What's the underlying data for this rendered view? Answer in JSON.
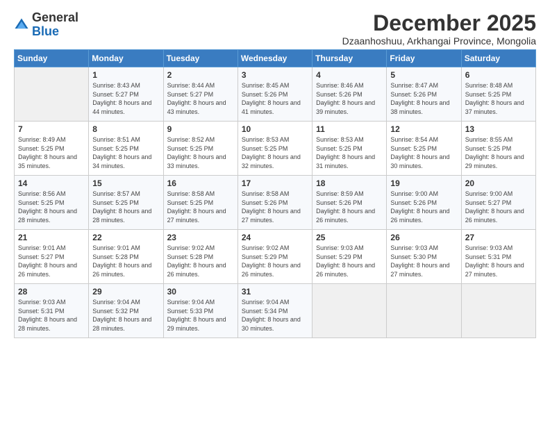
{
  "logo": {
    "general": "General",
    "blue": "Blue"
  },
  "header": {
    "month_year": "December 2025",
    "location": "Dzaanhoshuu, Arkhangai Province, Mongolia"
  },
  "days_of_week": [
    "Sunday",
    "Monday",
    "Tuesday",
    "Wednesday",
    "Thursday",
    "Friday",
    "Saturday"
  ],
  "weeks": [
    [
      {
        "day": "",
        "sunrise": "",
        "sunset": "",
        "daylight": ""
      },
      {
        "day": "1",
        "sunrise": "Sunrise: 8:43 AM",
        "sunset": "Sunset: 5:27 PM",
        "daylight": "Daylight: 8 hours and 44 minutes."
      },
      {
        "day": "2",
        "sunrise": "Sunrise: 8:44 AM",
        "sunset": "Sunset: 5:27 PM",
        "daylight": "Daylight: 8 hours and 43 minutes."
      },
      {
        "day": "3",
        "sunrise": "Sunrise: 8:45 AM",
        "sunset": "Sunset: 5:26 PM",
        "daylight": "Daylight: 8 hours and 41 minutes."
      },
      {
        "day": "4",
        "sunrise": "Sunrise: 8:46 AM",
        "sunset": "Sunset: 5:26 PM",
        "daylight": "Daylight: 8 hours and 39 minutes."
      },
      {
        "day": "5",
        "sunrise": "Sunrise: 8:47 AM",
        "sunset": "Sunset: 5:26 PM",
        "daylight": "Daylight: 8 hours and 38 minutes."
      },
      {
        "day": "6",
        "sunrise": "Sunrise: 8:48 AM",
        "sunset": "Sunset: 5:25 PM",
        "daylight": "Daylight: 8 hours and 37 minutes."
      }
    ],
    [
      {
        "day": "7",
        "sunrise": "Sunrise: 8:49 AM",
        "sunset": "Sunset: 5:25 PM",
        "daylight": "Daylight: 8 hours and 35 minutes."
      },
      {
        "day": "8",
        "sunrise": "Sunrise: 8:51 AM",
        "sunset": "Sunset: 5:25 PM",
        "daylight": "Daylight: 8 hours and 34 minutes."
      },
      {
        "day": "9",
        "sunrise": "Sunrise: 8:52 AM",
        "sunset": "Sunset: 5:25 PM",
        "daylight": "Daylight: 8 hours and 33 minutes."
      },
      {
        "day": "10",
        "sunrise": "Sunrise: 8:53 AM",
        "sunset": "Sunset: 5:25 PM",
        "daylight": "Daylight: 8 hours and 32 minutes."
      },
      {
        "day": "11",
        "sunrise": "Sunrise: 8:53 AM",
        "sunset": "Sunset: 5:25 PM",
        "daylight": "Daylight: 8 hours and 31 minutes."
      },
      {
        "day": "12",
        "sunrise": "Sunrise: 8:54 AM",
        "sunset": "Sunset: 5:25 PM",
        "daylight": "Daylight: 8 hours and 30 minutes."
      },
      {
        "day": "13",
        "sunrise": "Sunrise: 8:55 AM",
        "sunset": "Sunset: 5:25 PM",
        "daylight": "Daylight: 8 hours and 29 minutes."
      }
    ],
    [
      {
        "day": "14",
        "sunrise": "Sunrise: 8:56 AM",
        "sunset": "Sunset: 5:25 PM",
        "daylight": "Daylight: 8 hours and 28 minutes."
      },
      {
        "day": "15",
        "sunrise": "Sunrise: 8:57 AM",
        "sunset": "Sunset: 5:25 PM",
        "daylight": "Daylight: 8 hours and 28 minutes."
      },
      {
        "day": "16",
        "sunrise": "Sunrise: 8:58 AM",
        "sunset": "Sunset: 5:25 PM",
        "daylight": "Daylight: 8 hours and 27 minutes."
      },
      {
        "day": "17",
        "sunrise": "Sunrise: 8:58 AM",
        "sunset": "Sunset: 5:26 PM",
        "daylight": "Daylight: 8 hours and 27 minutes."
      },
      {
        "day": "18",
        "sunrise": "Sunrise: 8:59 AM",
        "sunset": "Sunset: 5:26 PM",
        "daylight": "Daylight: 8 hours and 26 minutes."
      },
      {
        "day": "19",
        "sunrise": "Sunrise: 9:00 AM",
        "sunset": "Sunset: 5:26 PM",
        "daylight": "Daylight: 8 hours and 26 minutes."
      },
      {
        "day": "20",
        "sunrise": "Sunrise: 9:00 AM",
        "sunset": "Sunset: 5:27 PM",
        "daylight": "Daylight: 8 hours and 26 minutes."
      }
    ],
    [
      {
        "day": "21",
        "sunrise": "Sunrise: 9:01 AM",
        "sunset": "Sunset: 5:27 PM",
        "daylight": "Daylight: 8 hours and 26 minutes."
      },
      {
        "day": "22",
        "sunrise": "Sunrise: 9:01 AM",
        "sunset": "Sunset: 5:28 PM",
        "daylight": "Daylight: 8 hours and 26 minutes."
      },
      {
        "day": "23",
        "sunrise": "Sunrise: 9:02 AM",
        "sunset": "Sunset: 5:28 PM",
        "daylight": "Daylight: 8 hours and 26 minutes."
      },
      {
        "day": "24",
        "sunrise": "Sunrise: 9:02 AM",
        "sunset": "Sunset: 5:29 PM",
        "daylight": "Daylight: 8 hours and 26 minutes."
      },
      {
        "day": "25",
        "sunrise": "Sunrise: 9:03 AM",
        "sunset": "Sunset: 5:29 PM",
        "daylight": "Daylight: 8 hours and 26 minutes."
      },
      {
        "day": "26",
        "sunrise": "Sunrise: 9:03 AM",
        "sunset": "Sunset: 5:30 PM",
        "daylight": "Daylight: 8 hours and 27 minutes."
      },
      {
        "day": "27",
        "sunrise": "Sunrise: 9:03 AM",
        "sunset": "Sunset: 5:31 PM",
        "daylight": "Daylight: 8 hours and 27 minutes."
      }
    ],
    [
      {
        "day": "28",
        "sunrise": "Sunrise: 9:03 AM",
        "sunset": "Sunset: 5:31 PM",
        "daylight": "Daylight: 8 hours and 28 minutes."
      },
      {
        "day": "29",
        "sunrise": "Sunrise: 9:04 AM",
        "sunset": "Sunset: 5:32 PM",
        "daylight": "Daylight: 8 hours and 28 minutes."
      },
      {
        "day": "30",
        "sunrise": "Sunrise: 9:04 AM",
        "sunset": "Sunset: 5:33 PM",
        "daylight": "Daylight: 8 hours and 29 minutes."
      },
      {
        "day": "31",
        "sunrise": "Sunrise: 9:04 AM",
        "sunset": "Sunset: 5:34 PM",
        "daylight": "Daylight: 8 hours and 30 minutes."
      },
      {
        "day": "",
        "sunrise": "",
        "sunset": "",
        "daylight": ""
      },
      {
        "day": "",
        "sunrise": "",
        "sunset": "",
        "daylight": ""
      },
      {
        "day": "",
        "sunrise": "",
        "sunset": "",
        "daylight": ""
      }
    ]
  ]
}
